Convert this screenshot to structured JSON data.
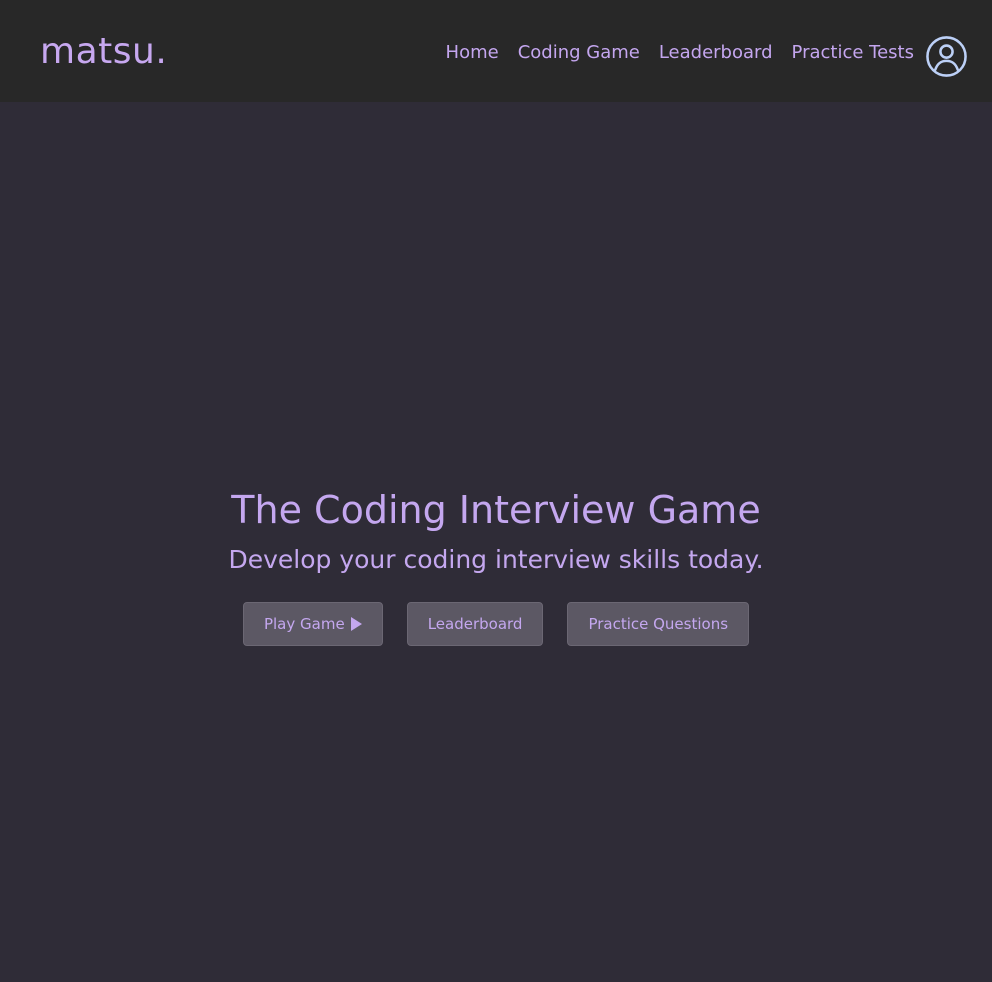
{
  "brand": {
    "name": "matsu."
  },
  "nav": {
    "links": [
      {
        "label": "Home"
      },
      {
        "label": "Coding Game"
      },
      {
        "label": "Leaderboard"
      },
      {
        "label": "Practice Tests"
      }
    ],
    "profile_icon": "user-circle-icon"
  },
  "hero": {
    "title": "The Coding Interview Game",
    "subtitle": "Develop your coding interview skills today."
  },
  "buttons": {
    "play": {
      "label": "Play Game",
      "icon": "play-icon"
    },
    "leaderboard": {
      "label": "Leaderboard"
    },
    "practice": {
      "label": "Practice Questions"
    }
  },
  "colors": {
    "background": "#2f2c37",
    "navbar": "#282828",
    "accent": "#c4a7ef",
    "button": "#5c5864"
  }
}
